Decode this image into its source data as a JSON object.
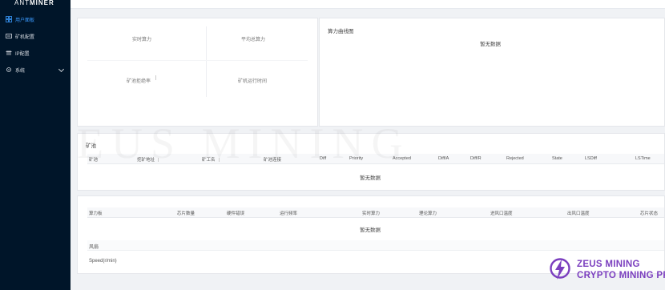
{
  "app": {
    "logo_light": "ANT",
    "logo_bold": "MINER"
  },
  "sidebar": {
    "items": [
      {
        "label": "用户面板",
        "icon": "dashboard-icon"
      },
      {
        "label": "矿机配置",
        "icon": "miner-config-icon"
      },
      {
        "label": "IP配置",
        "icon": "network-icon"
      },
      {
        "label": "系统",
        "icon": "system-icon"
      }
    ]
  },
  "stats": {
    "realtime_hashrate_label": "实时算力",
    "avg_hashrate_label": "平均总算力",
    "pool_reject_label": "矿池拒绝率",
    "uptime_label": "矿机运行时间"
  },
  "hashrate_chart": {
    "title": "算力曲线图",
    "empty": "暂无数据"
  },
  "pools": {
    "title": "矿池",
    "columns": [
      "矿池",
      "挖矿地址",
      "矿工名",
      "矿池连接",
      "Diff",
      "Priority",
      "Accepted",
      "Diff/A",
      "Diff/R",
      "Rejected",
      "State",
      "LSDiff",
      "LSTime"
    ],
    "empty": "暂无数据"
  },
  "boards": {
    "columns": [
      "算力板",
      "芯片数量",
      "硬件错误",
      "运行频率",
      "实时算力",
      "理论算力",
      "进风口温度",
      "出风口温度",
      "芯片状态"
    ],
    "empty": "暂无数据",
    "fan_label": "风扇",
    "speed_label": "Speed(r/min)"
  },
  "watermark": "EUS MINING",
  "brand": {
    "line1": "ZEUS MINING",
    "line2": "CRYPTO MINING PRO",
    "color": "#7b3fbf"
  },
  "colors": {
    "sidebar_bg": "#001529",
    "active": "#3a9bff"
  }
}
